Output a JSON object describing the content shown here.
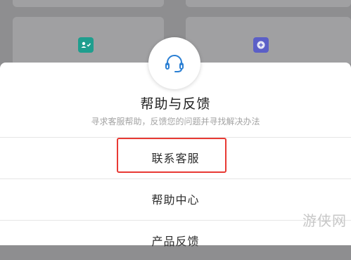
{
  "background_app": {
    "icons": [
      "contact-card-icon",
      "add-circle-icon"
    ]
  },
  "sheet": {
    "icon": "headset-icon",
    "title": "帮助与反馈",
    "subtitle": "寻求客服帮助，反馈您的问题并寻找解决办法",
    "options": [
      {
        "label": "联系客服"
      },
      {
        "label": "帮助中心"
      },
      {
        "label": "产品反馈"
      }
    ]
  },
  "watermark": "游侠网",
  "colors": {
    "highlight": "#e83a34",
    "icon_blue": "#2a7fd3",
    "teal": "#1f9e8e",
    "purple": "#5b5fc7"
  }
}
